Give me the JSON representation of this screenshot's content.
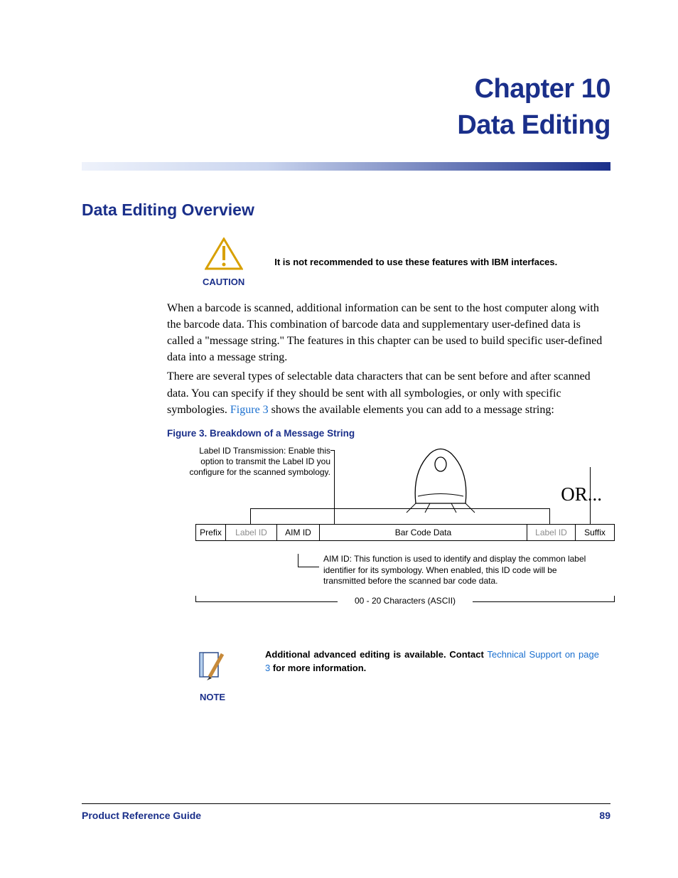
{
  "chapter": {
    "number": "Chapter 10",
    "title": "Data Editing"
  },
  "section": {
    "heading": "Data Editing Overview"
  },
  "caution": {
    "label": "CAUTION",
    "text": "It is not recommended to use these features with IBM interfaces."
  },
  "paragraphs": {
    "p1": "When a barcode is scanned, additional information can be sent to the host computer along with the barcode data. This combination of barcode data and supplementary user-defined data is called a \"message string.\" The features in this chapter can be used to build specific user-defined data into a message string.",
    "p2a": "There are several types of selectable data characters that can be sent before and after scanned data. You can specify if they should be sent with all symbologies, or only with specific symbologies. ",
    "fig_link": "Figure 3",
    "p2b": " shows the available elements you can add to a message string:"
  },
  "figure": {
    "caption": "Figure 3. Breakdown of a Message String",
    "labelid_callout": "Label ID Transmission: Enable this option to transmit the Label ID you configure for the scanned symbology.",
    "or_text": "OR...",
    "cells": {
      "prefix": "Prefix",
      "labelid": "Label ID",
      "aimid": "AIM ID",
      "barcode": "Bar Code Data",
      "labelid2": "Label ID",
      "suffix": "Suffix"
    },
    "aim_callout": "AIM ID: This function is used to identify and display the common label identifier for its symbology. When enabled, this ID code will be transmitted before the scanned bar code data.",
    "chars": "00 - 20 Characters (ASCII)"
  },
  "note": {
    "label": "NOTE",
    "pre": "Additional advanced editing is available. Contact ",
    "link": "Technical Support on page 3",
    "post": " for more information."
  },
  "footer": {
    "left": "Product Reference Guide",
    "right": "89"
  }
}
